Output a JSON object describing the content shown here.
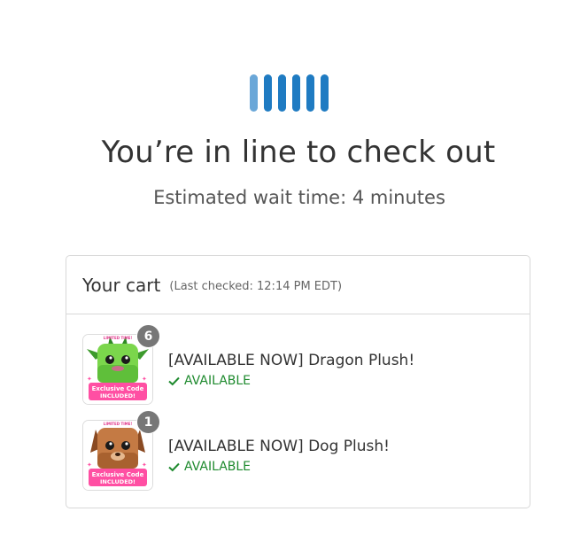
{
  "heading": "You’re in line to check out",
  "wait_text": "Estimated wait time: 4 minutes",
  "cart": {
    "title": "Your cart",
    "last_checked": "(Last checked: 12:14 PM EDT)",
    "items": [
      {
        "name": "[AVAILABLE NOW] Dragon Plush!",
        "status": "AVAILABLE",
        "quantity": "6",
        "thumb_text_top": "LIMITED TIME!",
        "thumb_text_line1": "Exclusive Code",
        "thumb_text_line2": "INCLUDED!"
      },
      {
        "name": "[AVAILABLE NOW] Dog Plush!",
        "status": "AVAILABLE",
        "quantity": "1",
        "thumb_text_top": "LIMITED TIME!",
        "thumb_text_line1": "Exclusive Code",
        "thumb_text_line2": "INCLUDED!"
      }
    ]
  },
  "colors": {
    "loader": "#1f7bc2",
    "loader_light": "#6aa7d8",
    "available": "#1e8a2e",
    "badge": "#777777"
  },
  "icons": {
    "loader": "loading-bars-icon",
    "status": "checkmark-icon"
  }
}
